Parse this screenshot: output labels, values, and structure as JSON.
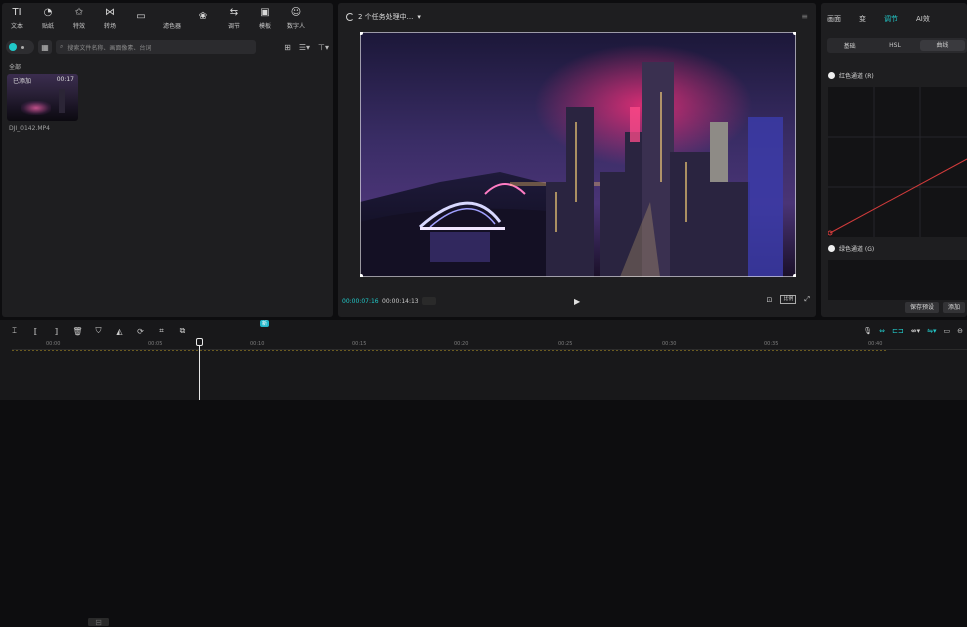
{
  "left_panel": {
    "tools": [
      {
        "icon": "TI",
        "label": "文本"
      },
      {
        "icon": "◔",
        "label": "贴纸"
      },
      {
        "icon": "✩",
        "label": "特效"
      },
      {
        "icon": "⋈",
        "label": "转场"
      },
      {
        "icon": "▭",
        "label": ""
      },
      {
        "icon": "",
        "label": "滤色器"
      },
      {
        "icon": "❀",
        "label": ""
      },
      {
        "icon": "⇆",
        "label": "调节"
      },
      {
        "icon": "▣",
        "label": "模板"
      },
      {
        "icon": "☺",
        "label": "数字人"
      }
    ],
    "search_placeholder": "搜索文件名称、画面像素、台词",
    "section_label": "全部",
    "media": {
      "badge": "已添加",
      "duration": "00:17",
      "filename": "DJI_0142.MP4"
    }
  },
  "player": {
    "title": "2 个任务处理中...",
    "current_time": "00:00:07:16",
    "total_time": "00:00:14:13",
    "ratio_label": "比例"
  },
  "right_panel": {
    "tabs": [
      "画面",
      "变",
      "",
      "调节",
      "AI效"
    ],
    "active_tab": "调节",
    "subtabs": [
      "基础",
      "HSL",
      "曲线",
      ""
    ],
    "active_subtab": "曲线",
    "red_channel": "红色通道 (R)",
    "green_channel": "绿色通道 (G)",
    "save_preset": "保存预设",
    "add_button": "添加"
  },
  "timeline": {
    "new_badge": "新",
    "ticks": [
      "00:00",
      "00:05",
      "00:10",
      "00:15",
      "00:20",
      "00:25",
      "00:30",
      "00:35",
      "00:40"
    ]
  },
  "colors": {
    "accent": "#22c9c9",
    "panel_bg": "#1e1e20",
    "app_bg": "#0d0d0f",
    "curve_line": "#d23b3b"
  },
  "icons": {
    "media_view": "grid-icon",
    "sort": "sort-icon",
    "filter": "filter-icon",
    "play": "play-icon",
    "fullscreen": "fullscreen-icon",
    "mic": "microphone-icon"
  }
}
